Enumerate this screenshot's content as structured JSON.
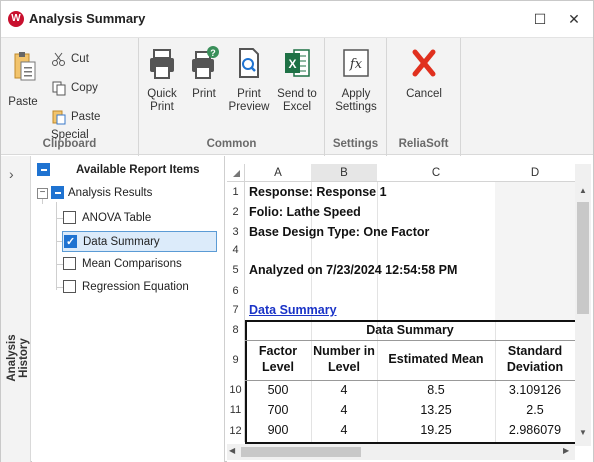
{
  "window": {
    "title": "Analysis Summary",
    "logo": "W",
    "minimize_glyph": "☐",
    "close_glyph": "✕"
  },
  "ribbon": {
    "clipboard": {
      "label": "Clipboard",
      "paste": "Paste",
      "cut": "Cut",
      "copy": "Copy",
      "paste_special": "Paste Special"
    },
    "common": {
      "label": "Common",
      "quick_print_1": "Quick",
      "quick_print_2": "Print",
      "print": "Print",
      "print_preview_1": "Print",
      "print_preview_2": "Preview",
      "send_excel_1": "Send to",
      "send_excel_2": "Excel"
    },
    "settings": {
      "label": "Settings",
      "apply_1": "Apply",
      "apply_2": "Settings"
    },
    "reliasoft": {
      "label": "ReliaSoft",
      "cancel": "Cancel"
    }
  },
  "history": {
    "label": "Analysis History",
    "chevron": "›"
  },
  "tree": {
    "root": "Available Report Items",
    "group": "Analysis Results",
    "items": [
      {
        "label": "ANOVA Table",
        "checked": false
      },
      {
        "label": "Data Summary",
        "checked": true
      },
      {
        "label": "Mean Comparisons",
        "checked": false
      },
      {
        "label": "Regression Equation",
        "checked": false
      }
    ]
  },
  "sheet": {
    "columns": [
      "A",
      "B",
      "C",
      "D"
    ],
    "rows": [
      "1",
      "2",
      "3",
      "4",
      "5",
      "6",
      "7",
      "8",
      "9",
      "10",
      "11",
      "12"
    ],
    "line1": "Response: Response 1",
    "line2": "Folio: Lathe Speed",
    "line3": "Base Design Type: One Factor",
    "line5": "Analyzed on 7/23/2024 12:54:58 PM",
    "section_link": "Data Summary",
    "table_title": "Data Summary",
    "headers": [
      {
        "l1": "Factor",
        "l2": "Level"
      },
      {
        "l1": "Number in",
        "l2": "Level"
      },
      {
        "l1": "Estimated Mean",
        "l2": ""
      },
      {
        "l1": "Standard",
        "l2": "Deviation"
      }
    ],
    "data": [
      [
        "500",
        "4",
        "8.5",
        "3.109126"
      ],
      [
        "700",
        "4",
        "13.25",
        "2.5"
      ],
      [
        "900",
        "4",
        "19.25",
        "2.986079"
      ]
    ],
    "scroll_up": "▲",
    "scroll_down": "▼",
    "scroll_left": "◀",
    "scroll_right": "▶"
  },
  "colors": {
    "link": "#1a33c7",
    "accent": "#1f73d1",
    "cancel_red": "#e0301e",
    "excel_green": "#1e7145",
    "logo_red": "#c8102e"
  }
}
